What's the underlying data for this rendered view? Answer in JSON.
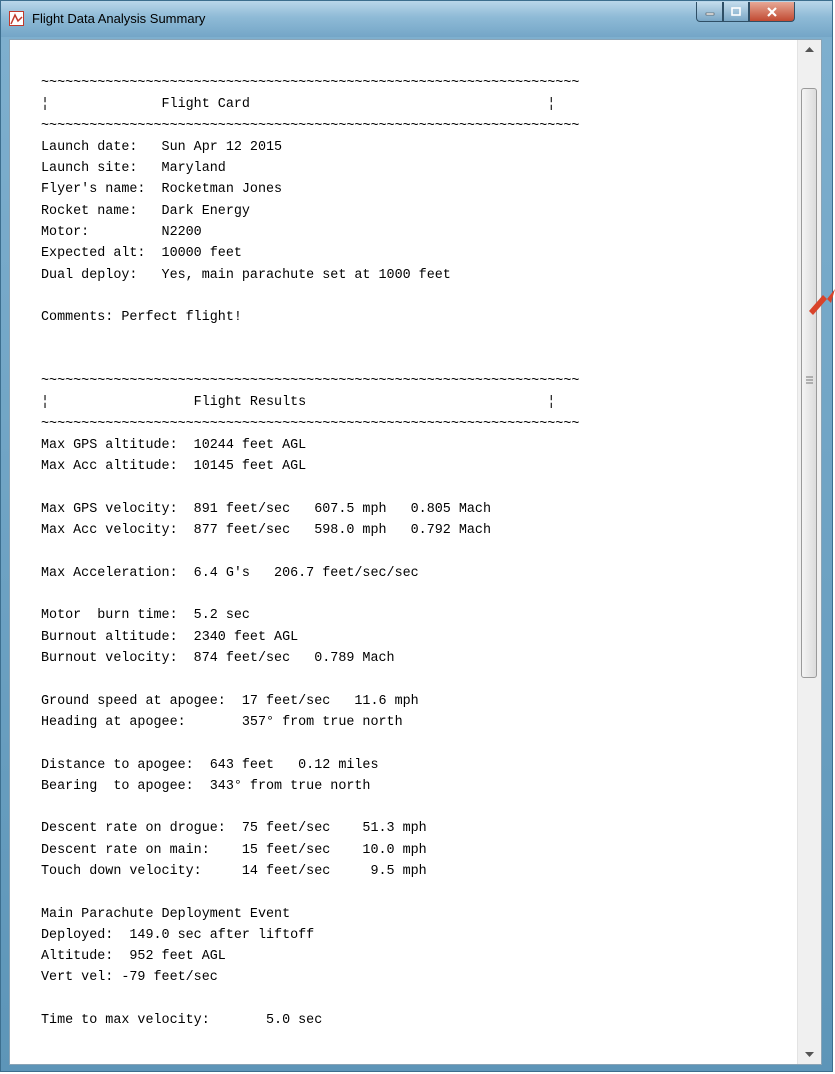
{
  "window": {
    "title": "Flight Data Analysis Summary",
    "controls": {
      "minimize": "minimize",
      "maximize": "maximize",
      "close": "close"
    },
    "accent_color": "#7fb0cf",
    "close_color": "#c14a32"
  },
  "report": {
    "lines": [
      "~~~~~~~~~~~~~~~~~~~~~~~~~~~~~~~~~~~~~~~~~~~~~~~~~~~~~~~~~~~~~~~~~~~",
      "¦              Flight Card                                     ¦",
      "~~~~~~~~~~~~~~~~~~~~~~~~~~~~~~~~~~~~~~~~~~~~~~~~~~~~~~~~~~~~~~~~~~~",
      "Launch date:   Sun Apr 12 2015",
      "Launch site:   Maryland",
      "Flyer's name:  Rocketman Jones",
      "Rocket name:   Dark Energy",
      "Motor:         N2200",
      "Expected alt:  10000 feet",
      "Dual deploy:   Yes, main parachute set at 1000 feet",
      "",
      "Comments: Perfect flight!",
      "",
      "",
      "~~~~~~~~~~~~~~~~~~~~~~~~~~~~~~~~~~~~~~~~~~~~~~~~~~~~~~~~~~~~~~~~~~~",
      "¦                  Flight Results                              ¦",
      "~~~~~~~~~~~~~~~~~~~~~~~~~~~~~~~~~~~~~~~~~~~~~~~~~~~~~~~~~~~~~~~~~~~",
      "Max GPS altitude:  10244 feet AGL",
      "Max Acc altitude:  10145 feet AGL",
      "",
      "Max GPS velocity:  891 feet/sec   607.5 mph   0.805 Mach",
      "Max Acc velocity:  877 feet/sec   598.0 mph   0.792 Mach",
      "",
      "Max Acceleration:  6.4 G's   206.7 feet/sec/sec",
      "",
      "Motor  burn time:  5.2 sec",
      "Burnout altitude:  2340 feet AGL",
      "Burnout velocity:  874 feet/sec   0.789 Mach",
      "",
      "Ground speed at apogee:  17 feet/sec   11.6 mph",
      "Heading at apogee:       357° from true north",
      "",
      "Distance to apogee:  643 feet   0.12 miles",
      "Bearing  to apogee:  343° from true north",
      "",
      "Descent rate on drogue:  75 feet/sec    51.3 mph",
      "Descent rate on main:    15 feet/sec    10.0 mph",
      "Touch down velocity:     14 feet/sec     9.5 mph",
      "",
      "Main Parachute Deployment Event",
      "Deployed:  149.0 sec after liftoff",
      "Altitude:  952 feet AGL",
      "Vert vel: -79 feet/sec",
      "",
      "Time to max velocity:       5.0 sec"
    ]
  },
  "scrollbar": {
    "up_icon": "scroll-up-arrow",
    "down_icon": "scroll-down-arrow",
    "scroll_position_fraction": 0.0
  },
  "annotation": {
    "icon": "red-arrow-pointer",
    "color": "#d9432a"
  }
}
